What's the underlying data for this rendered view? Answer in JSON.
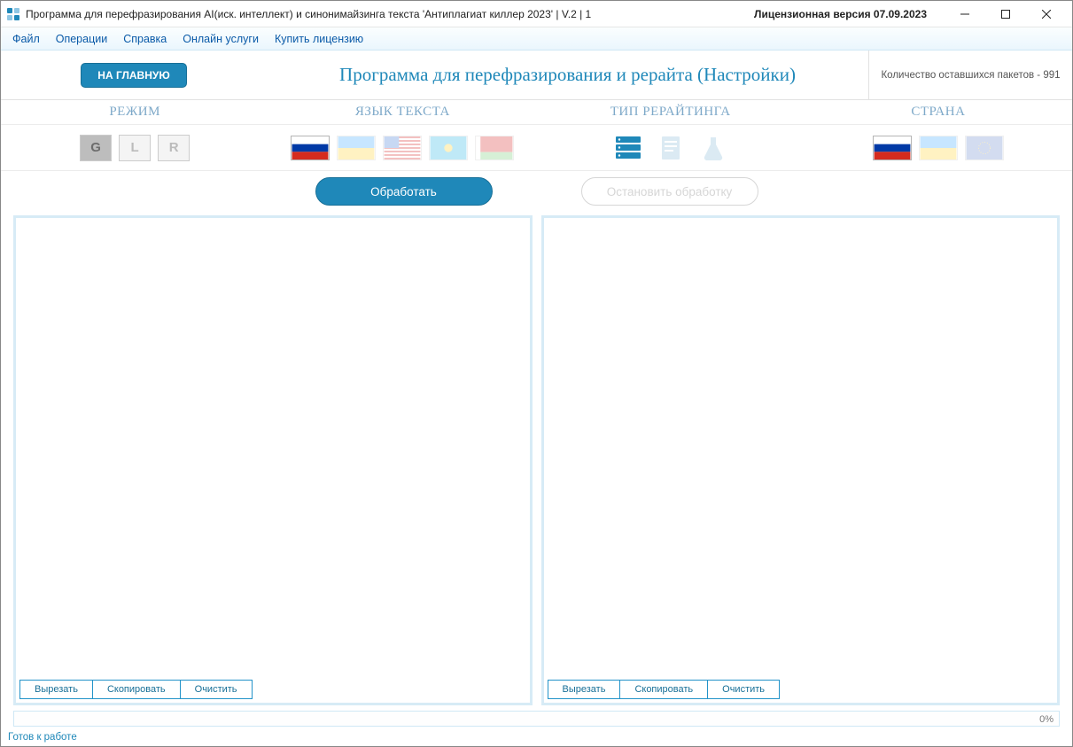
{
  "titlebar": {
    "title": "Программа для перефразирования AI(иск. интеллект) и синонимайзинга текста 'Антиплагиат киллер 2023' | V.2 | 1",
    "license": "Лицензионная версия 07.09.2023"
  },
  "menu": {
    "file": "Файл",
    "operations": "Операции",
    "help": "Справка",
    "online": "Онлайн услуги",
    "buy": "Купить лицензию"
  },
  "top": {
    "home_btn": "НА ГЛАВНУЮ",
    "page_title": "Программа для перефразирования и рерайта (Настройки)",
    "packets": "Количество оставшихся пакетов - 991"
  },
  "headers": {
    "mode": "РЕЖИМ",
    "lang": "ЯЗЫК ТЕКСТА",
    "type": "ТИП РЕРАЙТИНГА",
    "country": "СТРАНА"
  },
  "modes": {
    "g": "G",
    "l": "L",
    "r": "R"
  },
  "actions": {
    "process": "Обработать",
    "stop": "Остановить обработку"
  },
  "panel_btns": {
    "cut": "Вырезать",
    "copy": "Скопировать",
    "clear": "Очистить"
  },
  "progress": {
    "pct": "0%"
  },
  "status": {
    "text": "Готов к работе"
  }
}
